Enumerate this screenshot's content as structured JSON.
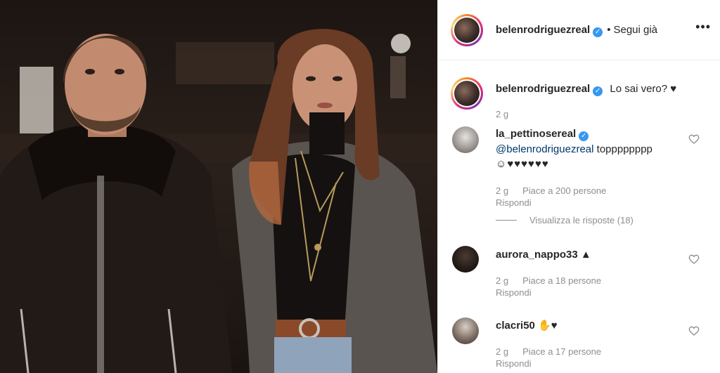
{
  "post": {
    "author": "belenrodriguezreal",
    "follow_dot": "•",
    "follow_status": "Segui già",
    "more_icon": "more-options-icon",
    "caption": "Lo sai vero? ♥",
    "caption_age": "2 g"
  },
  "comments": [
    {
      "username": "la_pettinosereal",
      "verified": true,
      "mention": "@belenrodriguezreal",
      "text": " topppppppp",
      "emoji_line": "☺♥♥♥♥♥♥",
      "age": "2 g",
      "likes": "Piace a 200 persone",
      "reply": "Rispondi",
      "view_replies": "Visualizza le risposte (18)"
    },
    {
      "username": "aurora_nappo33",
      "verified": false,
      "text": " ▲",
      "age": "2 g",
      "likes": "Piace a 18 persone",
      "reply": "Rispondi"
    },
    {
      "username": "clacri50",
      "verified": false,
      "text": " ✋♥",
      "age": "2 g",
      "likes": "Piace a 17 persone",
      "reply": "Rispondi"
    }
  ],
  "colors": {
    "link": "#00376b",
    "verified": "#3897f0",
    "meta": "#8e8e8e",
    "text": "#262626"
  }
}
